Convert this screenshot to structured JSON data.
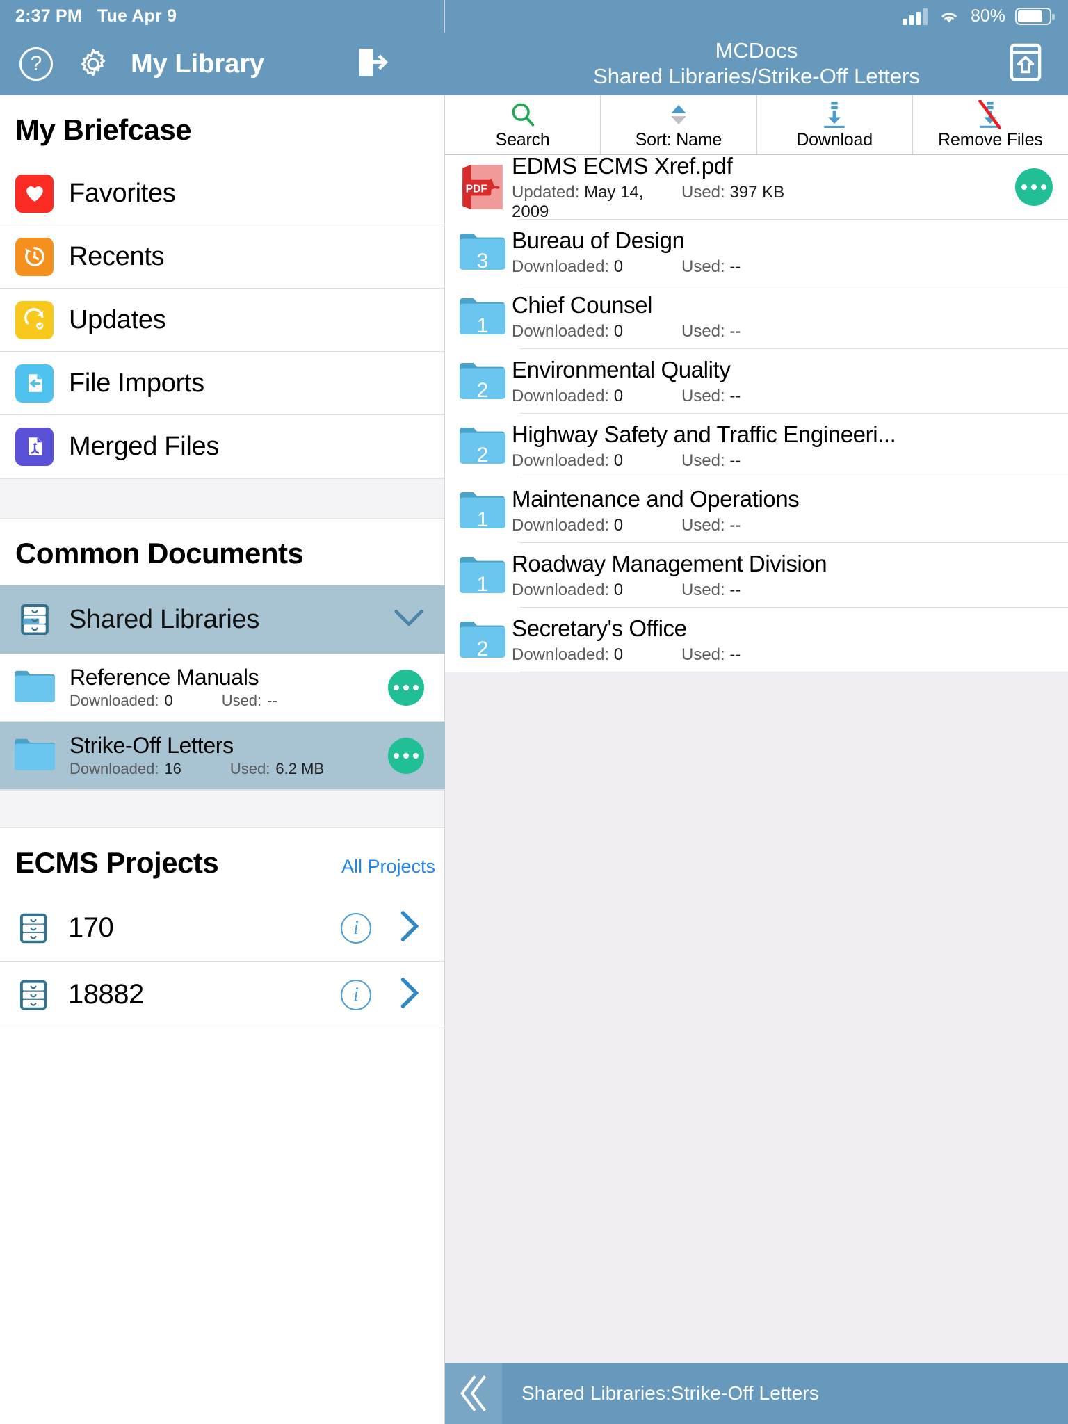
{
  "status_bar": {
    "time": "2:37 PM",
    "date": "Tue Apr 9",
    "battery_percent": "80%"
  },
  "left_nav": {
    "help_label": "?",
    "title": "My Library",
    "gear_icon": "gear-icon",
    "logout_icon": "logout-icon"
  },
  "briefcase": {
    "title": "My Briefcase",
    "items": [
      {
        "label": "Favorites",
        "icon": "heart-icon",
        "color": "#fa2b23"
      },
      {
        "label": "Recents",
        "icon": "clock-arrow-icon",
        "color": "#f5901e"
      },
      {
        "label": "Updates",
        "icon": "refresh-check-icon",
        "color": "#f9c81d"
      },
      {
        "label": "File Imports",
        "icon": "file-import-icon",
        "color": "#4ec3f0"
      },
      {
        "label": "Merged Files",
        "icon": "merged-file-icon",
        "color": "#5b51d8"
      }
    ]
  },
  "common_documents": {
    "title": "Common Documents",
    "library": {
      "label": "Shared Libraries",
      "icon": "file-cabinet-icon",
      "expanded": true
    },
    "children": [
      {
        "name": "Reference Manuals",
        "downloaded_label": "Downloaded:",
        "downloaded_value": "0",
        "used_label": "Used:",
        "used_value": "--",
        "selected": false
      },
      {
        "name": "Strike-Off Letters",
        "downloaded_label": "Downloaded:",
        "downloaded_value": "16",
        "used_label": "Used:",
        "used_value": "6.2 MB",
        "selected": true
      }
    ]
  },
  "ecms_projects": {
    "title": "ECMS Projects",
    "all_projects_label": "All Projects",
    "items": [
      {
        "label": "170",
        "icon": "file-cabinet-icon"
      },
      {
        "label": "18882",
        "icon": "file-cabinet-icon"
      }
    ]
  },
  "right_panel": {
    "app_title": "MCDocs",
    "breadcrumb_title": "Shared Libraries/Strike-Off Letters",
    "home_icon": "home-upload-icon",
    "toolbar": [
      {
        "label": "Search",
        "icon": "search-icon"
      },
      {
        "label": "Sort: Name",
        "icon": "sort-icon"
      },
      {
        "label": "Download",
        "icon": "download-icon"
      },
      {
        "label": "Remove Files",
        "icon": "remove-download-icon"
      }
    ],
    "rows": [
      {
        "type": "file",
        "name": "EDMS ECMS Xref.pdf",
        "icon": "pdf-icon",
        "meta1_label": "Updated:",
        "meta1_value": "May 14, 2009",
        "meta2_label": "Used:",
        "meta2_value": "397 KB",
        "has_menu": true
      },
      {
        "type": "folder",
        "name": "Bureau of Design",
        "icon": "folder-icon",
        "count": "3",
        "meta1_label": "Downloaded:",
        "meta1_value": "0",
        "meta2_label": "Used:",
        "meta2_value": "--",
        "has_menu": false
      },
      {
        "type": "folder",
        "name": "Chief Counsel",
        "icon": "folder-icon",
        "count": "1",
        "meta1_label": "Downloaded:",
        "meta1_value": "0",
        "meta2_label": "Used:",
        "meta2_value": "--",
        "has_menu": false
      },
      {
        "type": "folder",
        "name": "Environmental Quality",
        "icon": "folder-icon",
        "count": "2",
        "meta1_label": "Downloaded:",
        "meta1_value": "0",
        "meta2_label": "Used:",
        "meta2_value": "--",
        "has_menu": false
      },
      {
        "type": "folder",
        "name": "Highway Safety and Traffic Engineeri...",
        "icon": "folder-icon",
        "count": "2",
        "meta1_label": "Downloaded:",
        "meta1_value": "0",
        "meta2_label": "Used:",
        "meta2_value": "--",
        "has_menu": false
      },
      {
        "type": "folder",
        "name": "Maintenance and Operations",
        "icon": "folder-icon",
        "count": "1",
        "meta1_label": "Downloaded:",
        "meta1_value": "0",
        "meta2_label": "Used:",
        "meta2_value": "--",
        "has_menu": false
      },
      {
        "type": "folder",
        "name": "Roadway Management Division",
        "icon": "folder-icon",
        "count": "1",
        "meta1_label": "Downloaded:",
        "meta1_value": "0",
        "meta2_label": "Used:",
        "meta2_value": "--",
        "has_menu": false
      },
      {
        "type": "folder",
        "name": "Secretary's Office",
        "icon": "folder-icon",
        "count": "2",
        "meta1_label": "Downloaded:",
        "meta1_value": "0",
        "meta2_label": "Used:",
        "meta2_value": "--",
        "has_menu": false
      }
    ],
    "bottom_bar": {
      "back_icon": "double-chevron-left-icon",
      "path": "Shared Libraries:Strike-Off Letters"
    }
  },
  "colors": {
    "header_blue": "#6699bb",
    "selection_blue": "#a8c4d2",
    "accent_green": "#21bf95",
    "link_blue": "#1f86ef",
    "folder_blue": "#6ac6ef"
  }
}
